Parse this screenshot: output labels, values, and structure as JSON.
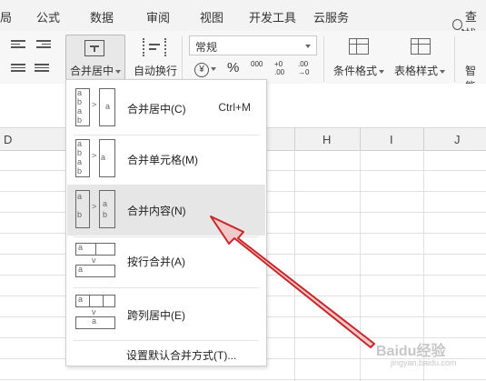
{
  "ribbon_tabs": [
    "局",
    "公式",
    "数据",
    "审阅",
    "视图",
    "开发工具",
    "云服务"
  ],
  "search_label": "查找",
  "toolbar": {
    "merge_label": "合并居中",
    "wrap_label": "自动换行",
    "number_format": "常规",
    "currency_symbol": "¥",
    "percent_symbol": "%",
    "thousands_symbol": "000",
    "inc_decimal": "+0 .00",
    "dec_decimal": ".00 →0",
    "conditional_format_label": "条件格式",
    "table_style_label": "表格样式",
    "smart_label": "智能"
  },
  "columns": [
    "D",
    "H",
    "I",
    "J"
  ],
  "merge_menu": {
    "items": [
      {
        "label": "合并居中(C)",
        "shortcut": "Ctrl+M",
        "icon": "merge-center-icon",
        "highlighted": false
      },
      {
        "label": "合并单元格(M)",
        "shortcut": "",
        "icon": "merge-cells-icon",
        "highlighted": false
      },
      {
        "label": "合并内容(N)",
        "shortcut": "",
        "icon": "merge-content-icon",
        "highlighted": true
      },
      {
        "label": "按行合并(A)",
        "shortcut": "",
        "icon": "merge-by-row-icon",
        "highlighted": false
      },
      {
        "label": "跨列居中(E)",
        "shortcut": "",
        "icon": "center-across-icon",
        "highlighted": false
      }
    ],
    "default_setting": "设置默认合并方式(T)...",
    "cell_letters_a": "a",
    "cell_letters_b": "b"
  },
  "annotation_arrow_color": "#c8282b",
  "watermark": {
    "brand": "Baidu经验",
    "url": "jingyan.baidu.com"
  }
}
